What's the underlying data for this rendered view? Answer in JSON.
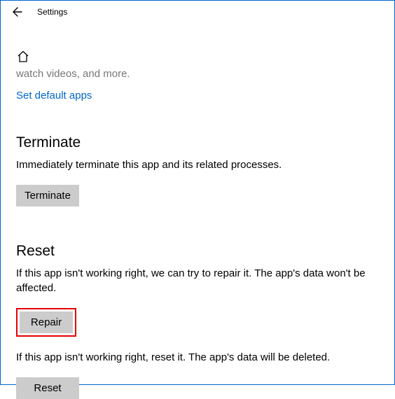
{
  "titlebar": {
    "title": "Settings"
  },
  "truncated_text": "watch videos, and more.",
  "link_set_default": "Set default apps",
  "terminate": {
    "heading": "Terminate",
    "desc": "Immediately terminate this app and its related processes.",
    "button": "Terminate"
  },
  "reset": {
    "heading": "Reset",
    "desc1": "If this app isn't working right, we can try to repair it. The app's data won't be affected.",
    "repair_button": "Repair",
    "desc2": "If this app isn't working right, reset it. The app's data will be deleted.",
    "reset_button": "Reset"
  }
}
